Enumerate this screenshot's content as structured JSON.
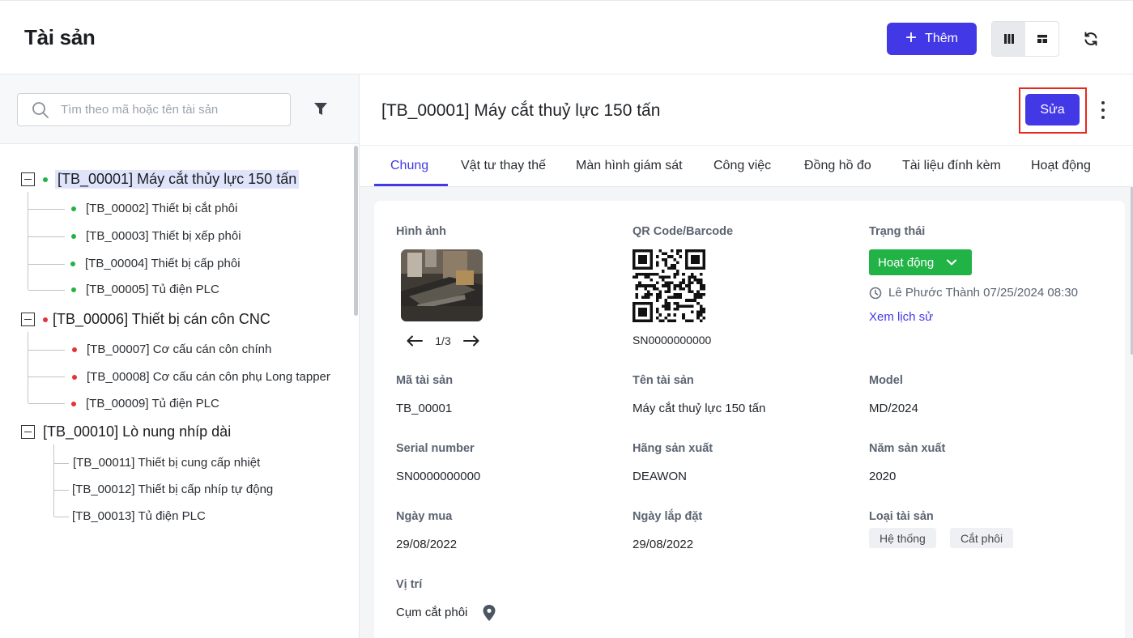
{
  "header": {
    "title": "Tài sản",
    "add_label": "Thêm",
    "view_icons": [
      "column-view-icon",
      "layout-view-icon"
    ],
    "refresh_icon": "refresh-icon"
  },
  "sidebar": {
    "search_placeholder": "Tìm theo mã hoặc tên tài sản",
    "filter_icon": "filter-icon",
    "tree": [
      {
        "label": "[TB_00001] Máy cắt thủy lực 150 tấn",
        "status": "green",
        "selected": true,
        "children": [
          {
            "label": "[TB_00002] Thiết bị cắt phôi",
            "status": "green"
          },
          {
            "label": "[TB_00003] Thiết bị xếp phôi",
            "status": "green"
          },
          {
            "label": "[TB_00004] Thiết bị cấp phôi",
            "status": "green"
          },
          {
            "label": "[TB_00005] Tủ điện PLC",
            "status": "green"
          }
        ]
      },
      {
        "label": "[TB_00006] Thiết bị cán côn CNC",
        "status": "red",
        "children": [
          {
            "label": "[TB_00007] Cơ cấu cán côn chính",
            "status": "red"
          },
          {
            "label": "[TB_00008] Cơ cấu cán côn phụ Long tapper",
            "status": "red"
          },
          {
            "label": "[TB_00009] Tủ điện PLC",
            "status": "red"
          }
        ]
      },
      {
        "label": "[TB_00010] Lò nung nhíp dài",
        "status": "none",
        "children": [
          {
            "label": "[TB_00011] Thiết bị cung cấp nhiệt",
            "status": "none"
          },
          {
            "label": "[TB_00012] Thiết bị cấp nhíp tự động",
            "status": "none"
          },
          {
            "label": "[TB_00013] Tủ điện PLC",
            "status": "none"
          }
        ]
      }
    ]
  },
  "detail": {
    "title": "[TB_00001] Máy cắt thuỷ lực 150 tấn",
    "edit_label": "Sửa",
    "tabs": [
      "Chung",
      "Vật tư thay thế",
      "Màn hình giám sát",
      "Công việc",
      "Đồng hồ đo",
      "Tài liệu đính kèm",
      "Hoạt động"
    ],
    "active_tab": "Chung",
    "image": {
      "label": "Hình ảnh",
      "pager": "1/3"
    },
    "qr": {
      "label": "QR Code/Barcode",
      "code": "SN0000000000"
    },
    "status": {
      "label": "Trạng thái",
      "value": "Hoạt động",
      "updated_by": "Lê Phước Thành 07/25/2024 08:30",
      "history_link": "Xem lịch sử"
    },
    "fields": {
      "asset_code": {
        "label": "Mã tài sản",
        "value": "TB_00001"
      },
      "asset_name": {
        "label": "Tên tài sản",
        "value": "Máy cắt thuỷ lực 150 tấn"
      },
      "model": {
        "label": "Model",
        "value": "MD/2024"
      },
      "serial": {
        "label": "Serial number",
        "value": "SN0000000000"
      },
      "manufacturer": {
        "label": "Hãng sản xuất",
        "value": "DEAWON"
      },
      "year": {
        "label": "Năm sản xuất",
        "value": "2020"
      },
      "purchase_date": {
        "label": "Ngày mua",
        "value": "29/08/2022"
      },
      "install_date": {
        "label": "Ngày lắp đặt",
        "value": "29/08/2022"
      },
      "asset_type": {
        "label": "Loại tài sản",
        "tags": [
          "Hệ thống",
          "Cắt phôi"
        ]
      },
      "location": {
        "label": "Vị trí",
        "value": "Cụm cắt phôi"
      }
    }
  },
  "colors": {
    "primary": "#4338e6",
    "status_green": "#22b347",
    "status_red": "#e5333a",
    "highlight_outline": "#e8281e"
  }
}
